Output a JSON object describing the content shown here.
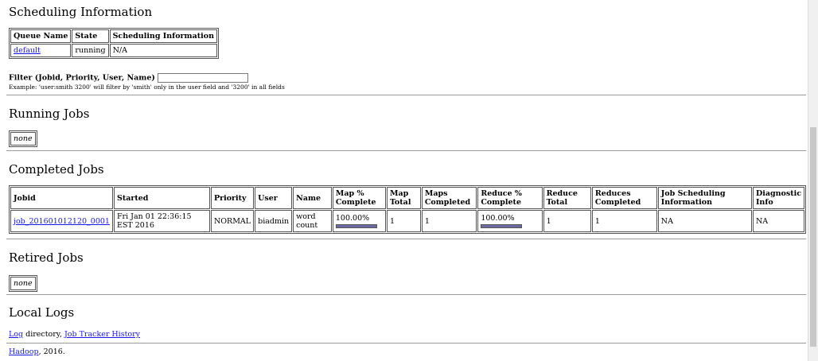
{
  "scheduling": {
    "title": "Scheduling Information",
    "headers": [
      "Queue Name",
      "State",
      "Scheduling Information"
    ],
    "row": {
      "queue": "default",
      "state": "running",
      "info": "N/A"
    }
  },
  "filter": {
    "label": "Filter (Jobid, Priority, User, Name)",
    "value": "",
    "hint": "Example: 'user:smith 3200' will filter by 'smith' only in the user field and '3200' in all fields"
  },
  "running": {
    "title": "Running Jobs",
    "empty": "none"
  },
  "completed": {
    "title": "Completed Jobs",
    "headers": {
      "jobid": "Jobid",
      "started": "Started",
      "priority": "Priority",
      "user": "User",
      "name": "Name",
      "map_pct": "Map % Complete",
      "map_total": "Map Total",
      "maps_done": "Maps Completed",
      "reduce_pct": "Reduce % Complete",
      "reduce_total": "Reduce Total",
      "reduces_done": "Reduces Completed",
      "sched_info": "Job Scheduling Information",
      "diag": "Diagnostic Info"
    },
    "row": {
      "jobid": "job_201601012120_0001",
      "started": "Fri Jan 01 22:36:15 EST 2016",
      "priority": "NORMAL",
      "user": "biadmin",
      "name": "word count",
      "map_pct": "100.00%",
      "map_progress": 100,
      "map_total": "1",
      "maps_done": "1",
      "reduce_pct": "100.00%",
      "reduce_progress": 100,
      "reduce_total": "1",
      "reduces_done": "1",
      "sched_info": "NA",
      "diag": "NA"
    }
  },
  "retired": {
    "title": "Retired Jobs",
    "empty": "none"
  },
  "local_logs": {
    "title": "Local Logs",
    "log_link": "Log",
    "dir_text": " directory, ",
    "history_link": "Job Tracker History"
  },
  "footer": {
    "link": "Hadoop",
    "text": ", 2016."
  }
}
